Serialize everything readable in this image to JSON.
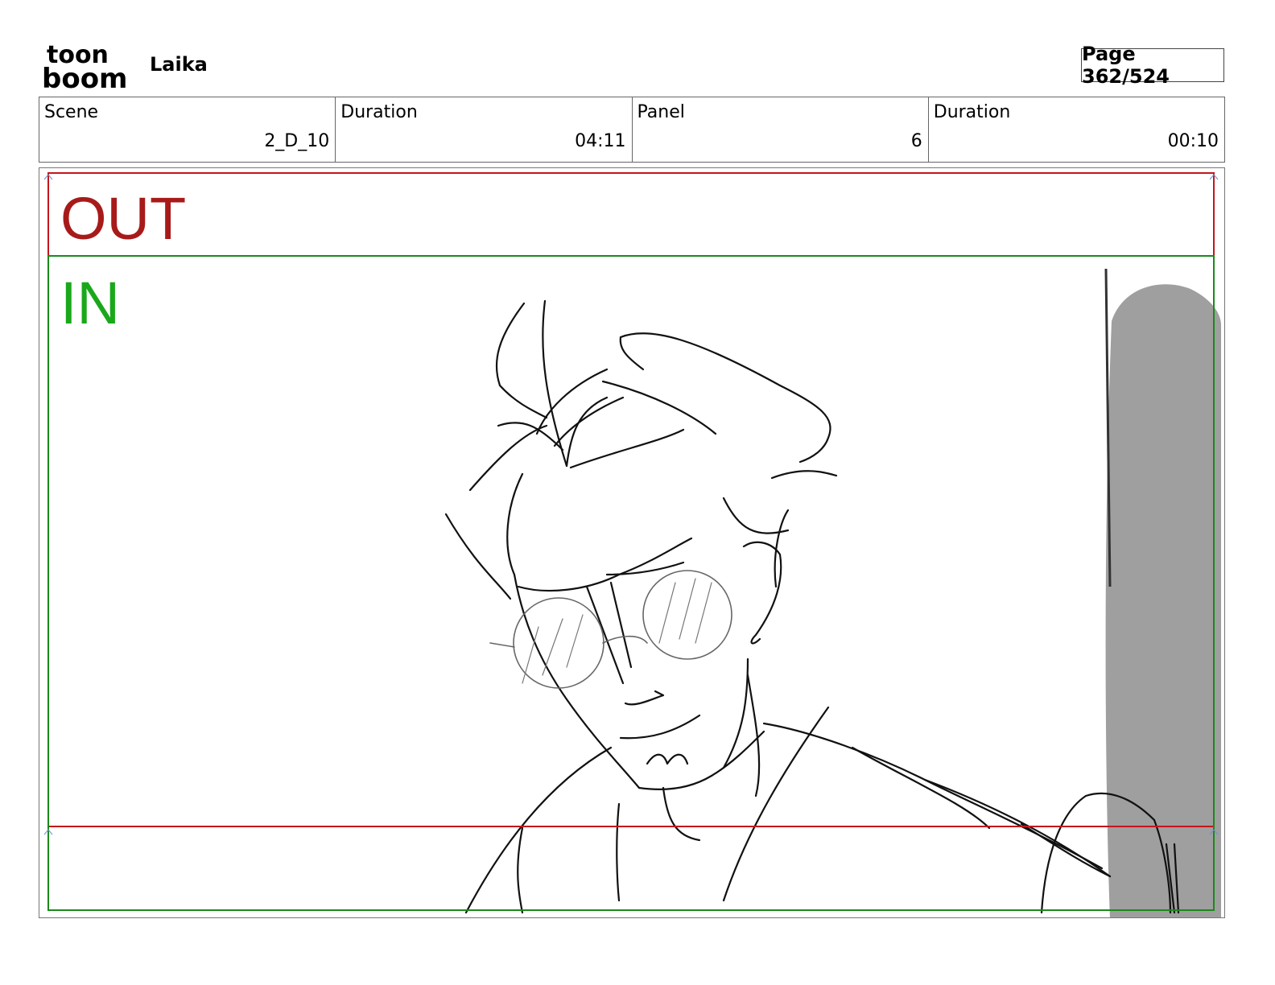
{
  "header": {
    "logo_text_top": "toon",
    "logo_text_bottom": "boom",
    "project_name": "Laika",
    "page_indicator": "Page 362/524"
  },
  "info": {
    "scene_label": "Scene",
    "scene_value": "2_D_10",
    "scene_duration_label": "Duration",
    "scene_duration_value": "04:11",
    "panel_label": "Panel",
    "panel_value": "6",
    "panel_duration_label": "Duration",
    "panel_duration_value": "00:10"
  },
  "panel": {
    "out_label": "OUT",
    "in_label": "IN",
    "colors": {
      "out_frame": "#c4161c",
      "in_frame": "#1a8a1a",
      "out_text": "#a81a1a",
      "in_text": "#1aa81a",
      "shadow": "#9a9a9a"
    }
  }
}
